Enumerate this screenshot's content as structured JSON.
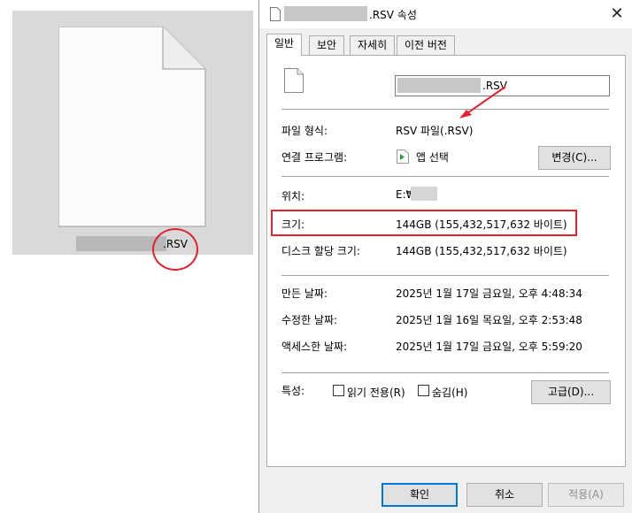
{
  "file_tile": {
    "extension": ".RSV"
  },
  "dialog": {
    "title": ".RSV 속성",
    "close_glyph": "✕",
    "tabs": [
      {
        "label": "일반",
        "active": true
      },
      {
        "label": "보안"
      },
      {
        "label": "자세히"
      },
      {
        "label": "이전 버전"
      }
    ],
    "name_extension": ".RSV",
    "rows": {
      "file_type": {
        "label": "파일 형식:",
        "value": "RSV 파일(.RSV)"
      },
      "opens_with": {
        "label": "연결 프로그램:",
        "value": "앱 선택",
        "button": "변경(C)..."
      },
      "location": {
        "label": "위치:",
        "value": "E:₩"
      },
      "size": {
        "label": "크기:",
        "value": "144GB (155,432,517,632 바이트)"
      },
      "size_on_disk": {
        "label": "디스크 할당 크기:",
        "value": "144GB (155,432,517,632 바이트)"
      },
      "created": {
        "label": "만든 날짜:",
        "value": "2025년 1월 17일 금요일, 오후 4:48:34"
      },
      "modified": {
        "label": "수정한 날짜:",
        "value": "2025년 1월 16일 목요일, 오후 2:53:48"
      },
      "accessed": {
        "label": "액세스한 날짜:",
        "value": "2025년 1월 17일 금요일, 오후 5:59:20"
      }
    },
    "attributes": {
      "label": "특성:",
      "readonly": "읽기 전용(R)",
      "hidden": "숨김(H)",
      "advanced_button": "고급(D)..."
    },
    "footer": {
      "ok": "확인",
      "cancel": "취소",
      "apply": "적용(A)"
    }
  },
  "colors": {
    "annotation": "#e0232c",
    "focus": "#0078d7",
    "tile_bg": "#d9d9d9"
  },
  "icons": [
    "document-icon",
    "close-icon",
    "app-store-icon",
    "checkbox-icon"
  ]
}
